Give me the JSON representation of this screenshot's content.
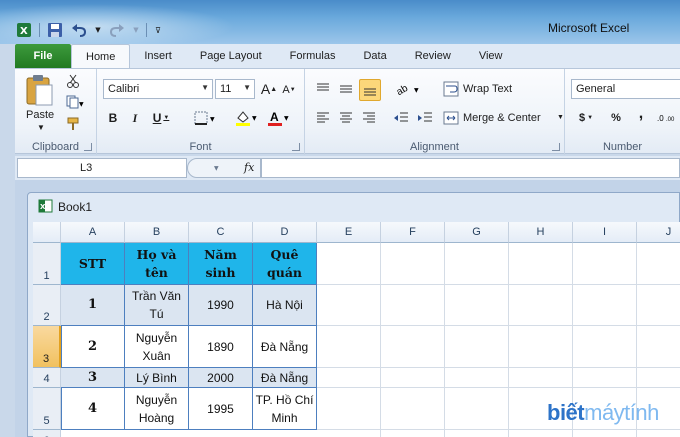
{
  "window": {
    "title": "Microsoft Excel"
  },
  "tabs": [
    "File",
    "Home",
    "Insert",
    "Page Layout",
    "Formulas",
    "Data",
    "Review",
    "View"
  ],
  "ribbon": {
    "clipboard": {
      "label": "Clipboard",
      "paste": "Paste"
    },
    "font": {
      "label": "Font",
      "name": "Calibri",
      "size": "11"
    },
    "alignment": {
      "label": "Alignment",
      "wrap_text": "Wrap Text",
      "merge_center": "Merge & Center"
    },
    "number": {
      "label": "Number",
      "format": "General",
      "currency": "$",
      "percent": "%",
      "comma": ","
    }
  },
  "formula_bar": {
    "name_box": "L3",
    "fx": "fx",
    "content": ""
  },
  "workbook": {
    "title": "Book1"
  },
  "sheet": {
    "columns": [
      "A",
      "B",
      "C",
      "D",
      "E",
      "F",
      "G",
      "H",
      "I",
      "J"
    ],
    "rows": [
      "1",
      "2",
      "3",
      "4",
      "5",
      "6"
    ],
    "selected_row": "3",
    "table": {
      "headers": [
        "STT",
        "Họ và tên",
        "Năm sinh",
        "Quê quán"
      ],
      "rows": [
        [
          "1",
          "Trần Văn Tú",
          "1990",
          "Hà Nội"
        ],
        [
          "2",
          "Nguyễn Xuân",
          "1890",
          "Đà Nẵng"
        ],
        [
          "3",
          "Lý Bình",
          "2000",
          "Đà Nẵng"
        ],
        [
          "4",
          "Nguyễn Hoàng",
          "1995",
          "TP. Hồ Chí Minh"
        ]
      ]
    }
  },
  "watermark": {
    "part1": "biết",
    "part2": "máytính"
  },
  "colors": {
    "header_fill": "#1fb5ea",
    "band_fill": "#dbe5f1",
    "file_tab": "#2a8a2a",
    "border": "#4d7fbf"
  }
}
